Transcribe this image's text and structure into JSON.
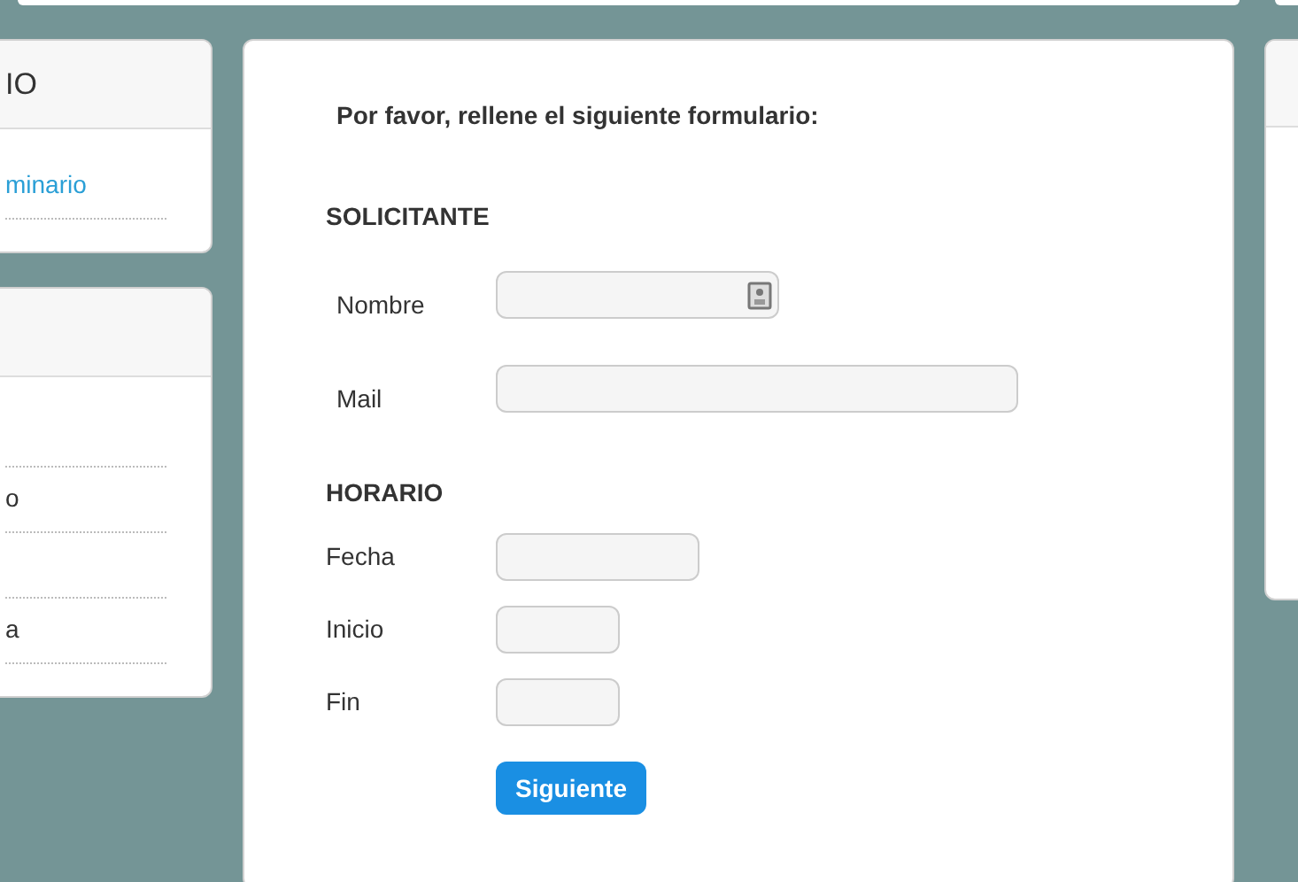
{
  "left_panels": [
    {
      "title": "IO",
      "items": [
        {
          "text": "minario",
          "kind": "link"
        }
      ]
    },
    {
      "items": [
        {
          "kind": "plain"
        },
        {
          "text": "o",
          "kind": "plain"
        },
        {
          "kind": "plain"
        },
        {
          "text": "a",
          "kind": "plain"
        }
      ]
    }
  ],
  "form": {
    "intro": "Por favor, rellene el siguiente formulario:",
    "sections": [
      {
        "title": "SOLICITANTE",
        "fields": [
          {
            "label": "Nombre",
            "kind": "contact"
          },
          {
            "label": "Mail",
            "kind": "email"
          }
        ]
      },
      {
        "title": "HORARIO",
        "fields": [
          {
            "label": "Fecha",
            "kind": "date"
          },
          {
            "label": "Inicio",
            "kind": "time"
          },
          {
            "label": "Fin",
            "kind": "time"
          }
        ]
      }
    ],
    "button": "Siguiente"
  }
}
